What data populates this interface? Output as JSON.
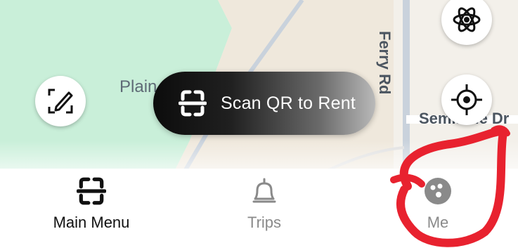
{
  "map": {
    "label_plain": "Plain",
    "label_road": "Ferry Rd",
    "label_drive": "Seminole Dr"
  },
  "scan": {
    "label": "Scan QR to Rent",
    "icon": "scan-frame-icon"
  },
  "map_buttons": {
    "report_icon": "edit-report-icon",
    "layers_icon": "atom-layers-icon",
    "locate_icon": "crosshair-locate-icon"
  },
  "nav": {
    "items": [
      {
        "label": "Main Menu",
        "icon": "scan-frame-icon",
        "active": true
      },
      {
        "label": "Trips",
        "icon": "bell-icon",
        "active": false
      },
      {
        "label": "Me",
        "icon": "face-icon",
        "active": false
      }
    ]
  },
  "colors": {
    "park_green": "#c9efd9",
    "road": "#c9d2dc",
    "annotation_red": "#e8222f",
    "inactive_gray": "#8a8a8a"
  }
}
